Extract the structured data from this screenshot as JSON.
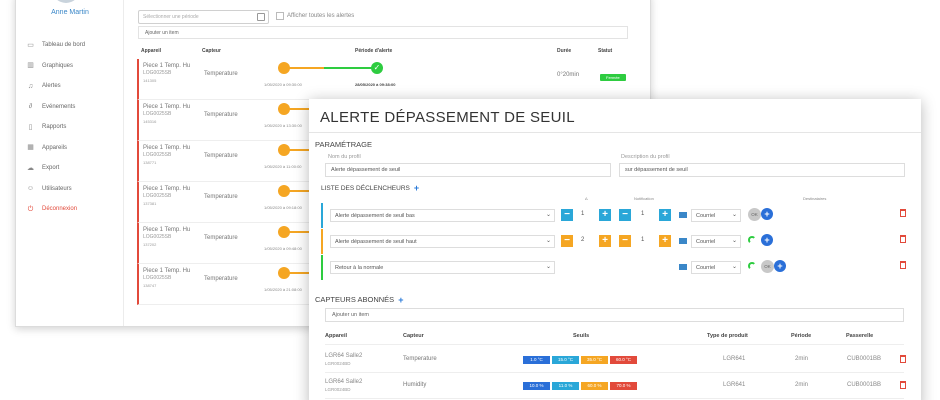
{
  "colors": {
    "accent": "#3a87c8",
    "alert_red": "#e24a3b",
    "ok_green": "#2ecc40",
    "warning_orange": "#f5a623",
    "info_blue": "#2aa7d8"
  },
  "sidebar": {
    "user_name": "Anne Martin",
    "items": [
      {
        "label": "Tableau de bord",
        "icon": "monitor-icon"
      },
      {
        "label": "Graphiques",
        "icon": "bar-chart-icon"
      },
      {
        "label": "Alertes",
        "icon": "bell-icon"
      },
      {
        "label": "Evénements",
        "icon": "paperclip-icon"
      },
      {
        "label": "Rapports",
        "icon": "document-icon"
      },
      {
        "label": "Appareils",
        "icon": "grid-icon"
      },
      {
        "label": "Export",
        "icon": "cloud-icon"
      },
      {
        "label": "Utilisateurs",
        "icon": "users-icon"
      },
      {
        "label": "Déconnexion",
        "icon": "power-icon"
      }
    ]
  },
  "alerts": {
    "date_placeholder": "Sélectionner une période",
    "show_all_label": "Afficher toutes les alertes",
    "add_item": "Ajouter un item",
    "columns": [
      "Appareil",
      "Capteur",
      "Période d'alerte",
      "Durée",
      "Statut"
    ],
    "rows": [
      {
        "device": "Piece 1 Temp. Hu",
        "ref": "LOG0025SB",
        "id": "141305",
        "sensor": "Temperature",
        "start": "1/05/2020 à 09:30:00",
        "end": "28/05/2020 à 09:38:00",
        "duration": "0°20min",
        "status": "Fermée"
      },
      {
        "device": "Piece 1 Temp. Hu",
        "ref": "LOG0025SB",
        "id": "145316",
        "sensor": "Temperature",
        "start": "1/05/2020 à 13:30:00"
      },
      {
        "device": "Piece 1 Temp. Hu",
        "ref": "LOG0025SB",
        "id": "138771",
        "sensor": "Temperature",
        "start": "1/05/2020 à 11:00:00"
      },
      {
        "device": "Piece 1 Temp. Hu",
        "ref": "LOG0025SB",
        "id": "137381",
        "sensor": "Temperature",
        "start": "1/05/2020 à 09:18:00"
      },
      {
        "device": "Piece 1 Temp. Hu",
        "ref": "LOG0025SB",
        "id": "137202",
        "sensor": "Temperature",
        "start": "1/05/2020 à 09:48:00"
      },
      {
        "device": "Piece 1 Temp. Hu",
        "ref": "LOG0025SB",
        "id": "138747",
        "sensor": "Temperature",
        "start": "1/05/2020 à 21:08:00"
      }
    ]
  },
  "modal": {
    "title": "ALERTE DÉPASSEMENT DE SEUIL",
    "section_params": "PARAMÉTRAGE",
    "profile_name_label": "Nom du profil",
    "profile_name_value": "Alerte dépassement de seuil",
    "profile_desc_label": "Description du profil",
    "profile_desc_value": "sur dépassement de seuil",
    "triggers_title": "LISTE DES DÉCLENCHEURS",
    "col_threshold": "Δ",
    "col_notification": "Notification",
    "col_recipients": "Destinataires",
    "triggers": [
      {
        "label": "Alerte dépassement de seuil bas",
        "count": "1",
        "notif": "1",
        "channel": "Courriel"
      },
      {
        "label": "Alerte dépassement de seuil haut",
        "count": "2",
        "notif": "1",
        "channel": "Courriel"
      },
      {
        "label": "Retour à la normale",
        "channel": "Courriel"
      }
    ],
    "ok_label": "OK",
    "sensors_title": "CAPTEURS ABONNÉS",
    "add_item": "Ajouter un item",
    "sensor_columns": [
      "Appareil",
      "Capteur",
      "Seuils",
      "Type de produit",
      "Période",
      "Passerelle"
    ],
    "sensors": [
      {
        "device": "LGR64 Salle2",
        "ref": "LGR0024BD",
        "sensor": "Temperature",
        "thresholds": [
          "1.0 °C",
          "15.0 °C",
          "35.0 °C",
          "60.0 °C"
        ],
        "type": "LGR641",
        "period": "2min",
        "gateway": "CUB0001BB"
      },
      {
        "device": "LGR64 Salle2",
        "ref": "LGR0024BD",
        "sensor": "Humidity",
        "thresholds": [
          "10.0 %",
          "11.0 %",
          "60.0 %",
          "70.0 %"
        ],
        "type": "LGR641",
        "period": "2min",
        "gateway": "CUB0001BB"
      }
    ]
  }
}
